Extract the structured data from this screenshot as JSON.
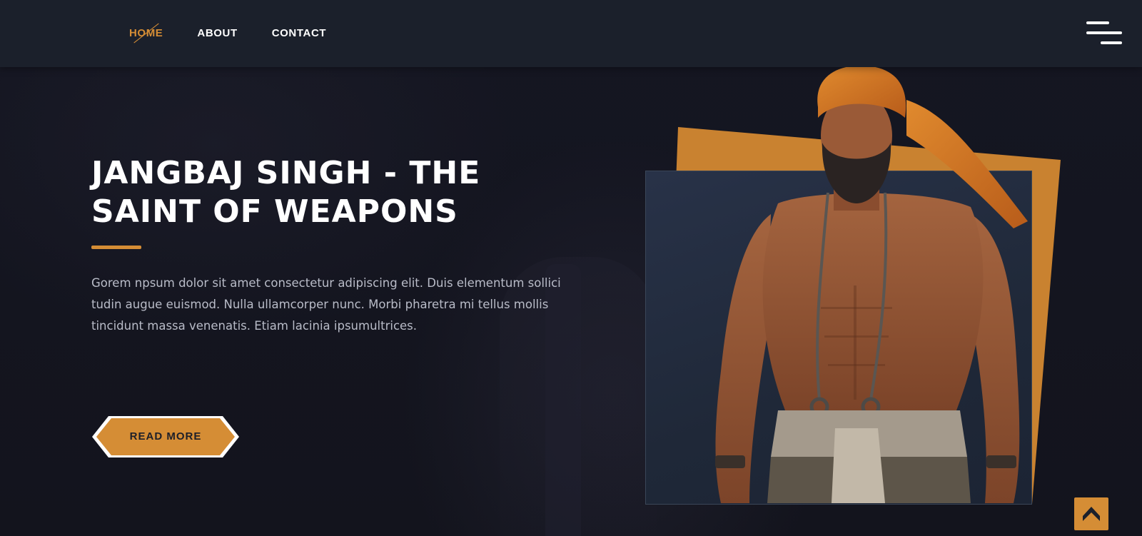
{
  "nav": {
    "items": [
      {
        "label": "HOME",
        "active": true
      },
      {
        "label": "ABOUT",
        "active": false
      },
      {
        "label": "CONTACT",
        "active": false
      }
    ],
    "menu_icon": "hamburger-menu-icon"
  },
  "hero": {
    "title_line1": "JANGBAJ SINGH - THE",
    "title_line2": "SAINT OF WEAPONS",
    "description": "Gorem npsum dolor sit amet consectetur adipiscing elit. Duis elementum sollici tudin augue euismod. Nulla ullamcorper nunc. Morbi pharetra mi tellus mollis tincidunt massa venenatis. Etiam lacinia ipsumultrices.",
    "button_label": "READ MORE"
  },
  "scroll_top": {
    "icon": "chevron-up-icon"
  },
  "colors": {
    "accent": "#d58d35",
    "header_bg": "#1b202b",
    "page_bg": "#14151f",
    "text": "#ffffff",
    "muted_text": "#b9bcc8"
  }
}
